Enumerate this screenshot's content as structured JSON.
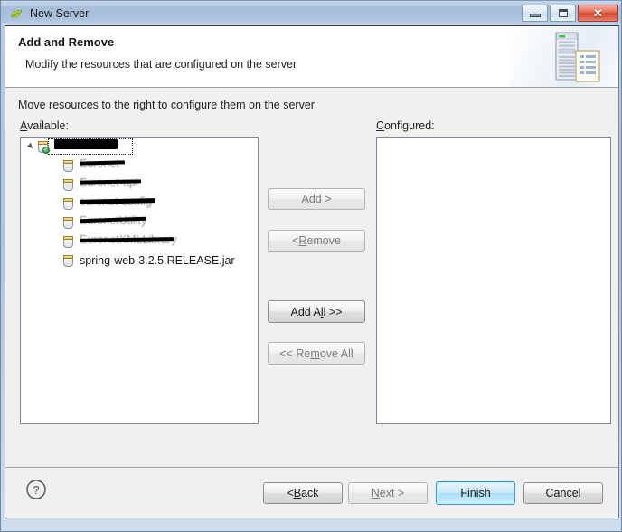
{
  "window": {
    "title": "New Server",
    "icon": "spring-leaf-icon",
    "controls": {
      "minimize": "minimize-icon",
      "maximize": "maximize-icon",
      "close": "close-icon",
      "close_glyph": "✕"
    }
  },
  "banner": {
    "title": "Add and Remove",
    "description": "Modify the resources that are configured on the server",
    "icon": "server-rack-document-icon"
  },
  "content": {
    "instruction": "Move resources to the right to configure them on the server",
    "available_label": "Available:",
    "available_mnemonic": "A",
    "configured_label": "Configured:",
    "configured_mnemonic": "C"
  },
  "available_tree": {
    "root": {
      "text": "",
      "redacted": true,
      "redacted_width": 70,
      "ghost": "",
      "icon": "jar-project-icon",
      "focused": true,
      "expanded": true
    },
    "children": [
      {
        "text": "",
        "redacted": true,
        "redacted_width": 46,
        "ghost": "Euronet",
        "icon": "jar-icon"
      },
      {
        "text": "",
        "redacted": true,
        "redacted_width": 62,
        "ghost": "Euronet-api",
        "icon": "jar-icon"
      },
      {
        "text": "",
        "redacted": true,
        "redacted_width": 80,
        "ghost": "euronet-config",
        "icon": "jar-icon"
      },
      {
        "text": "",
        "redacted": true,
        "redacted_width": 68,
        "ghost": "EuronetUtility",
        "icon": "jar-icon"
      },
      {
        "text": "",
        "redacted": true,
        "redacted_width": 98,
        "ghost": "EuronetXMLLibrary",
        "icon": "jar-icon"
      },
      {
        "text": "spring-web-3.2.5.RELEASE.jar",
        "redacted": false,
        "redacted_width": 0,
        "ghost": "",
        "icon": "jar-icon"
      }
    ]
  },
  "configured_tree": {
    "items": []
  },
  "transfer_buttons": {
    "add": {
      "label": "Add >",
      "mnemonic": "d",
      "enabled": false
    },
    "remove": {
      "label": "< Remove",
      "mnemonic": "R",
      "enabled": false
    },
    "add_all": {
      "label": "Add All >>",
      "mnemonic": "l",
      "enabled": true
    },
    "remove_all": {
      "label": "<< Remove All",
      "mnemonic": "m",
      "enabled": false
    }
  },
  "footer": {
    "help": "help-icon",
    "help_glyph": "?",
    "back": {
      "label": "< Back",
      "mnemonic": "B",
      "enabled": true
    },
    "next": {
      "label": "Next >",
      "mnemonic": "N",
      "enabled": false
    },
    "finish": {
      "label": "Finish",
      "enabled": true,
      "default": true
    },
    "cancel": {
      "label": "Cancel",
      "enabled": true
    }
  },
  "colors": {
    "titlebar_top": "#c7d8ea",
    "titlebar_bottom": "#c4d5e8",
    "dialog_bg": "#f0f0f0",
    "banner_bg": "#ffffff",
    "list_bg": "#ffffff",
    "list_border": "#7f8796",
    "default_button_border": "#2f9fd4",
    "close_button": "#d2442c",
    "redaction": "#000000"
  }
}
